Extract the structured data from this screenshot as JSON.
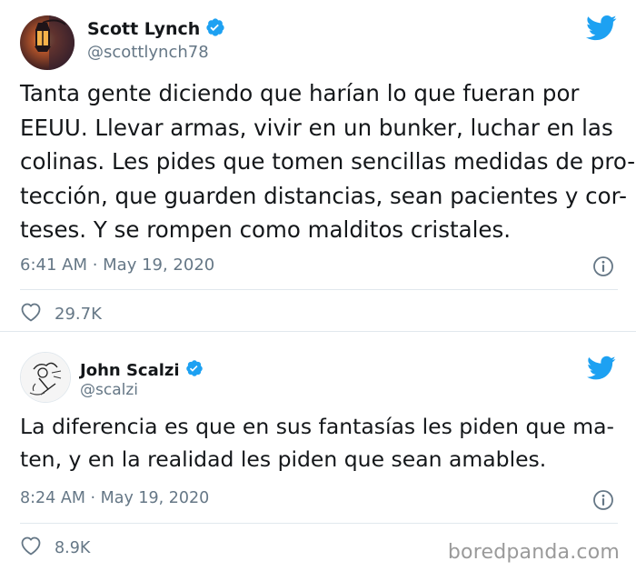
{
  "tweets": [
    {
      "author_name": "Scott Lynch",
      "author_handle": "@scottlynch78",
      "text_lines": [
        "Tanta gente diciendo que harían lo que fueran por",
        "EEUU. Llevar armas, vivir en un bunker, luchar en las",
        "colinas. Les pides que tomen sencillas medidas de pro-",
        "tección, que guarden distancias, sean pacientes y cor-",
        "teses. Y se rompen como malditos cristales."
      ],
      "timestamp": "6:41 AM · May 19, 2020",
      "likes": "29.7K"
    },
    {
      "author_name": "John Scalzi",
      "author_handle": "@scalzi",
      "text_lines": [
        "La diferencia es que en sus fantasías les piden que ma-",
        "ten, y en la realidad les piden que sean amables."
      ],
      "timestamp": "8:24 AM · May 19, 2020",
      "likes": "8.9K"
    }
  ],
  "watermark": "boredpanda.com",
  "colors": {
    "twitter_blue": "#1da1f2",
    "text_primary": "#14171a",
    "text_secondary": "#657786"
  },
  "icons": {
    "brand": "twitter-bird-icon",
    "verified": "verified-badge-icon",
    "info": "info-icon",
    "like": "heart-icon"
  }
}
